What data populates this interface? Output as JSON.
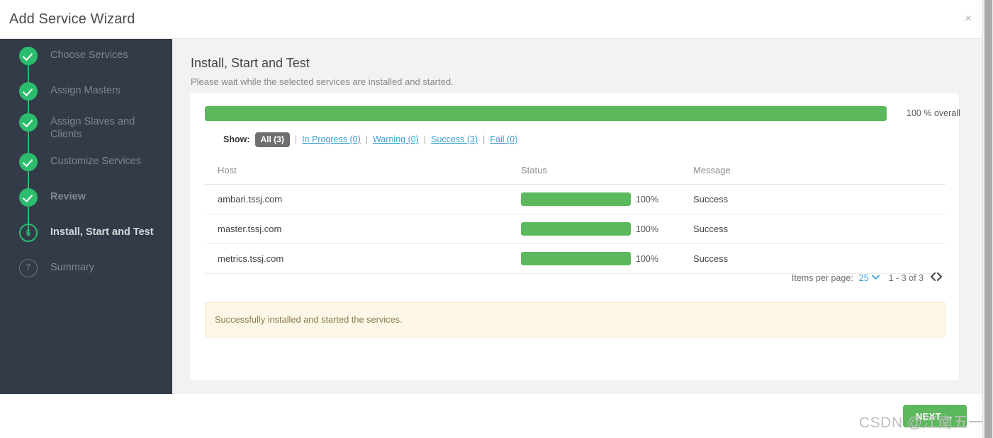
{
  "window": {
    "title": "Add Service Wizard",
    "close_label": "×"
  },
  "sidebar": {
    "steps": [
      {
        "num": "1",
        "label": "Choose Services",
        "state": "done"
      },
      {
        "num": "2",
        "label": "Assign Masters",
        "state": "done"
      },
      {
        "num": "3",
        "label": "Assign Slaves and Clients",
        "state": "done"
      },
      {
        "num": "4",
        "label": "Customize Services",
        "state": "done"
      },
      {
        "num": "5",
        "label": "Review",
        "state": "done"
      },
      {
        "num": "6",
        "label": "Install, Start and Test",
        "state": "current"
      },
      {
        "num": "7",
        "label": "Summary",
        "state": "pending"
      }
    ]
  },
  "main": {
    "title": "Install, Start and Test",
    "subtitle": "Please wait while the selected services are installed and started.",
    "overall": {
      "percent": 100,
      "text": "100 % overall"
    },
    "filter": {
      "show_label": "Show:",
      "separator": "|",
      "options": [
        {
          "label": "All (3)",
          "type": "chip",
          "active": true
        },
        {
          "label": "In Progress (0)",
          "type": "link",
          "active": false
        },
        {
          "label": "Warning (0)",
          "type": "link",
          "active": false
        },
        {
          "label": "Success (3)",
          "type": "link",
          "active": false
        },
        {
          "label": "Fail (0)",
          "type": "link",
          "active": false
        }
      ]
    },
    "table": {
      "columns": [
        "Host",
        "Status",
        "Message"
      ],
      "rows": [
        {
          "host": "ambari.tssj.com",
          "percent": 100,
          "percent_label": "100%",
          "message": "Success"
        },
        {
          "host": "master.tssj.com",
          "percent": 100,
          "percent_label": "100%",
          "message": "Success"
        },
        {
          "host": "metrics.tssj.com",
          "percent": 100,
          "percent_label": "100%",
          "message": "Success"
        }
      ]
    },
    "pagination": {
      "items_per_page_label": "Items per page:",
      "items_per_page_value": "25",
      "caret": "⌄",
      "range": "1 - 3 of 3",
      "prev": "‹",
      "next": "›",
      "arrows": "❮❯"
    },
    "alert": {
      "text": "Successfully installed and started the services."
    }
  },
  "footer": {
    "next_label": "NEXT",
    "next_arrow": "→"
  },
  "watermark": {
    "text": "CSDN @江南五一八"
  },
  "colors": {
    "sidebar_bg": "#333a48",
    "content_bg": "#f2f2f2",
    "green": "#5cb85c",
    "step_green": "#2bbc6e",
    "link_blue": "#3a9fd0",
    "chip_gray": "#6f6f6f",
    "alert_bg": "#fdf7e7",
    "alert_border": "#f4ead0",
    "success_text": "#4e8c4e"
  }
}
